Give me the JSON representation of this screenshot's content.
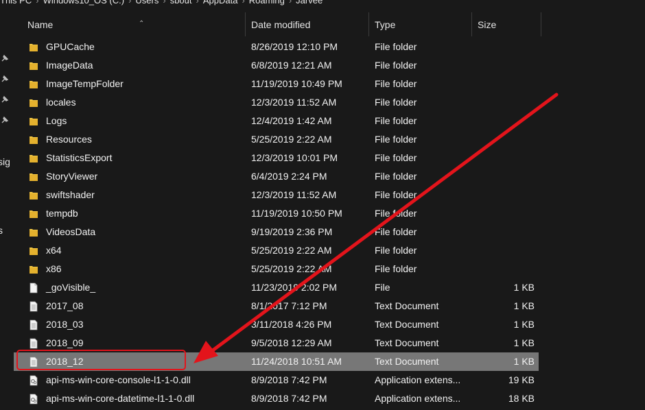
{
  "breadcrumb": {
    "items": [
      "This PC",
      "Windows10_OS (C:)",
      "Users",
      "sbout",
      "AppData",
      "Roaming",
      "Jarvee"
    ]
  },
  "navpane": {
    "fragments": [
      "sig",
      "s"
    ]
  },
  "columns": {
    "name": "Name",
    "date": "Date modified",
    "type": "Type",
    "size": "Size"
  },
  "files": [
    {
      "name": "GPUCache",
      "date": "8/26/2019 12:10 PM",
      "type": "File folder",
      "size": "",
      "icon": "folder-icon"
    },
    {
      "name": "ImageData",
      "date": "6/8/2019 12:21 AM",
      "type": "File folder",
      "size": "",
      "icon": "folder-icon"
    },
    {
      "name": "ImageTempFolder",
      "date": "11/19/2019 10:49 PM",
      "type": "File folder",
      "size": "",
      "icon": "folder-icon"
    },
    {
      "name": "locales",
      "date": "12/3/2019 11:52 AM",
      "type": "File folder",
      "size": "",
      "icon": "folder-icon"
    },
    {
      "name": "Logs",
      "date": "12/4/2019 1:42 AM",
      "type": "File folder",
      "size": "",
      "icon": "folder-icon"
    },
    {
      "name": "Resources",
      "date": "5/25/2019 2:22 AM",
      "type": "File folder",
      "size": "",
      "icon": "folder-icon"
    },
    {
      "name": "StatisticsExport",
      "date": "12/3/2019 10:01 PM",
      "type": "File folder",
      "size": "",
      "icon": "folder-icon"
    },
    {
      "name": "StoryViewer",
      "date": "6/4/2019 2:24 PM",
      "type": "File folder",
      "size": "",
      "icon": "folder-icon"
    },
    {
      "name": "swiftshader",
      "date": "12/3/2019 11:52 AM",
      "type": "File folder",
      "size": "",
      "icon": "folder-icon"
    },
    {
      "name": "tempdb",
      "date": "11/19/2019 10:50 PM",
      "type": "File folder",
      "size": "",
      "icon": "folder-icon"
    },
    {
      "name": "VideosData",
      "date": "9/19/2019 2:36 PM",
      "type": "File folder",
      "size": "",
      "icon": "folder-icon"
    },
    {
      "name": "x64",
      "date": "5/25/2019 2:22 AM",
      "type": "File folder",
      "size": "",
      "icon": "folder-icon"
    },
    {
      "name": "x86",
      "date": "5/25/2019 2:22 AM",
      "type": "File folder",
      "size": "",
      "icon": "folder-icon"
    },
    {
      "name": "_goVisible_",
      "date": "11/23/2019 2:02 PM",
      "type": "File",
      "size": "1 KB",
      "icon": "blank-file-icon"
    },
    {
      "name": "2017_08",
      "date": "8/1/2017 7:12 PM",
      "type": "Text Document",
      "size": "1 KB",
      "icon": "text-document-icon"
    },
    {
      "name": "2018_03",
      "date": "3/11/2018 4:26 PM",
      "type": "Text Document",
      "size": "1 KB",
      "icon": "text-document-icon"
    },
    {
      "name": "2018_09",
      "date": "9/5/2018 12:29 AM",
      "type": "Text Document",
      "size": "1 KB",
      "icon": "text-document-icon"
    },
    {
      "name": "2018_12",
      "date": "11/24/2018 10:51 AM",
      "type": "Text Document",
      "size": "1 KB",
      "icon": "text-document-icon",
      "selected": true
    },
    {
      "name": "api-ms-win-core-console-l1-1-0.dll",
      "date": "8/9/2018 7:42 PM",
      "type": "Application extens...",
      "size": "19 KB",
      "icon": "dll-file-icon"
    },
    {
      "name": "api-ms-win-core-datetime-l1-1-0.dll",
      "date": "8/9/2018 7:42 PM",
      "type": "Application extens...",
      "size": "18 KB",
      "icon": "dll-file-icon"
    }
  ],
  "colors": {
    "background": "#191919",
    "selected_row": "#777777",
    "folder": "#f0c542",
    "annotation": "#e3141b"
  }
}
